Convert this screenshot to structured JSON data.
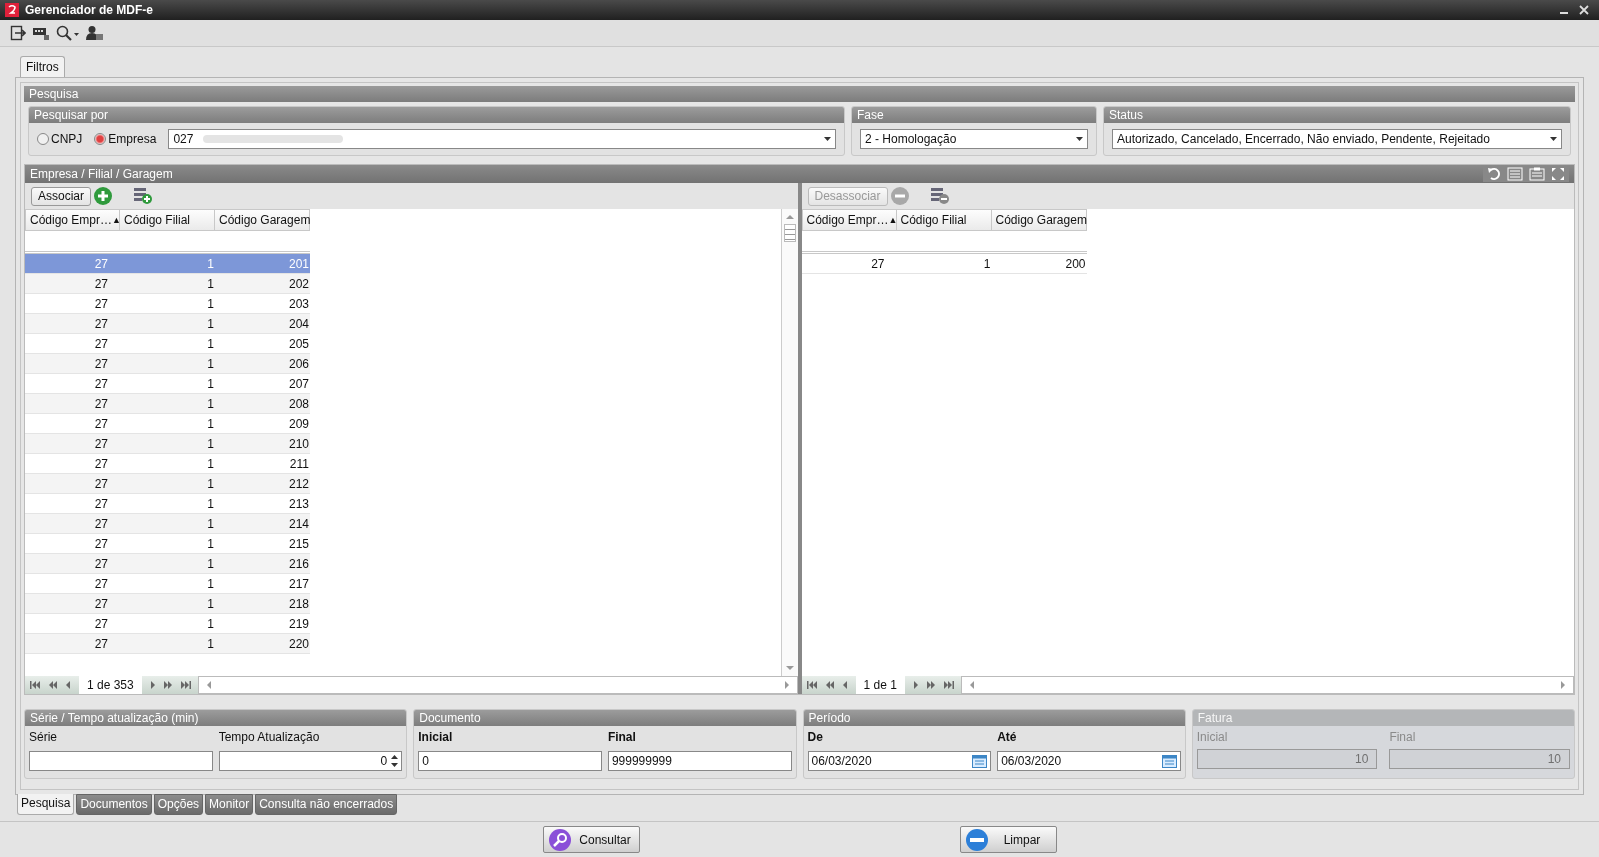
{
  "window": {
    "title": "Gerenciador de MDF-e"
  },
  "top_tab": {
    "label": "Filtros",
    "selected": true
  },
  "pesquisa": {
    "title": "Pesquisa",
    "pesquisar_por": {
      "title": "Pesquisar por",
      "options": [
        {
          "label": "CNPJ",
          "selected": false
        },
        {
          "label": "Empresa",
          "selected": true
        }
      ],
      "value": "027"
    },
    "fase": {
      "title": "Fase",
      "value": "2 - Homologação"
    },
    "status": {
      "title": "Status",
      "value": "Autorizado, Cancelado, Encerrado, Não enviado, Pendente, Rejeitado"
    }
  },
  "associacao": {
    "title": "Empresa / Filial / Garagem",
    "left": {
      "button": {
        "label": "Associar",
        "disabled": false
      },
      "columns": [
        {
          "label": "Código Empr…",
          "sort": "▲"
        },
        {
          "label": "Código Filial"
        },
        {
          "label": "Código Garagem"
        }
      ],
      "pager": "1 de 353",
      "rows": [
        {
          "cells": [
            "27",
            "1",
            "201"
          ],
          "selected": true
        },
        {
          "cells": [
            "27",
            "1",
            "202"
          ],
          "selected": false
        },
        {
          "cells": [
            "27",
            "1",
            "203"
          ],
          "selected": false
        },
        {
          "cells": [
            "27",
            "1",
            "204"
          ],
          "selected": false
        },
        {
          "cells": [
            "27",
            "1",
            "205"
          ],
          "selected": false
        },
        {
          "cells": [
            "27",
            "1",
            "206"
          ],
          "selected": false
        },
        {
          "cells": [
            "27",
            "1",
            "207"
          ],
          "selected": false
        },
        {
          "cells": [
            "27",
            "1",
            "208"
          ],
          "selected": false
        },
        {
          "cells": [
            "27",
            "1",
            "209"
          ],
          "selected": false
        },
        {
          "cells": [
            "27",
            "1",
            "210"
          ],
          "selected": false
        },
        {
          "cells": [
            "27",
            "1",
            "211"
          ],
          "selected": false
        },
        {
          "cells": [
            "27",
            "1",
            "212"
          ],
          "selected": false
        },
        {
          "cells": [
            "27",
            "1",
            "213"
          ],
          "selected": false
        },
        {
          "cells": [
            "27",
            "1",
            "214"
          ],
          "selected": false
        },
        {
          "cells": [
            "27",
            "1",
            "215"
          ],
          "selected": false
        },
        {
          "cells": [
            "27",
            "1",
            "216"
          ],
          "selected": false
        },
        {
          "cells": [
            "27",
            "1",
            "217"
          ],
          "selected": false
        },
        {
          "cells": [
            "27",
            "1",
            "218"
          ],
          "selected": false
        },
        {
          "cells": [
            "27",
            "1",
            "219"
          ],
          "selected": false
        },
        {
          "cells": [
            "27",
            "1",
            "220"
          ],
          "selected": false
        }
      ]
    },
    "right": {
      "button": {
        "label": "Desassociar",
        "disabled": true
      },
      "columns": [
        {
          "label": "Código Empr…",
          "sort": "▲"
        },
        {
          "label": "Código Filial"
        },
        {
          "label": "Código Garagem"
        }
      ],
      "pager": "1 de 1",
      "rows": [
        {
          "cells": [
            "27",
            "1",
            "200"
          ],
          "selected": false
        }
      ]
    }
  },
  "groups": [
    {
      "title": "Série / Tempo atualização (min)",
      "disabled": false,
      "bold_labels": false,
      "fields": [
        {
          "label": "Série",
          "kind": "text"
        },
        {
          "label": "Tempo Atualização",
          "value": "0",
          "kind": "spin"
        }
      ]
    },
    {
      "title": "Documento",
      "disabled": false,
      "bold_labels": true,
      "fields": [
        {
          "label": "Inicial",
          "value": "0",
          "kind": "text"
        },
        {
          "label": "Final",
          "value": "999999999",
          "kind": "text"
        }
      ]
    },
    {
      "title": "Período",
      "disabled": false,
      "bold_labels": true,
      "fields": [
        {
          "label": "De",
          "value": "06/03/2020",
          "kind": "date"
        },
        {
          "label": "Até",
          "value": "06/03/2020",
          "kind": "date"
        }
      ]
    },
    {
      "title": "Fatura",
      "disabled": true,
      "bold_labels": false,
      "fields": [
        {
          "label": "Inicial",
          "value": "10",
          "kind": "number"
        },
        {
          "label": "Final",
          "value": "10",
          "kind": "number"
        }
      ]
    }
  ],
  "bottom_tabs": [
    {
      "label": "Pesquisa",
      "selected": true
    },
    {
      "label": "Documentos",
      "selected": false
    },
    {
      "label": "Opções",
      "selected": false
    },
    {
      "label": "Monitor",
      "selected": false
    },
    {
      "label": "Consulta não encerrados",
      "selected": false
    }
  ],
  "actions": [
    {
      "label": "Consultar",
      "kind": "search"
    },
    {
      "label": "Limpar",
      "kind": "clear"
    }
  ]
}
